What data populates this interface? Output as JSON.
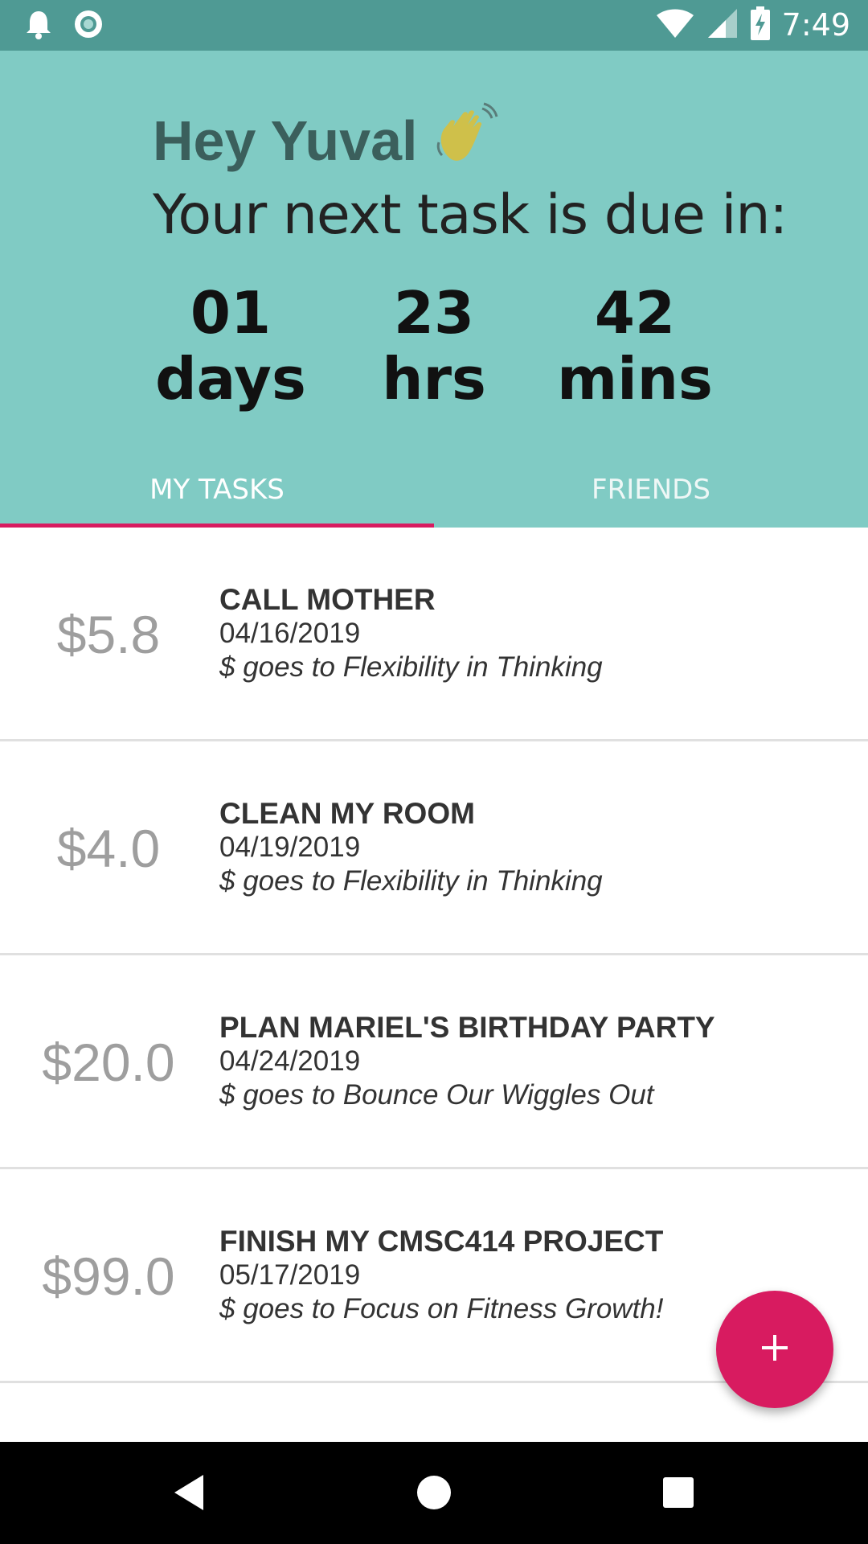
{
  "status_bar": {
    "time": "7:49",
    "icons": [
      "notification-bell-icon",
      "record-circle-icon",
      "wifi-icon",
      "cell-signal-icon",
      "battery-charging-icon"
    ]
  },
  "header": {
    "greeting": "Hey Yuval",
    "greeting_emoji_icon": "waving-hand-icon",
    "subtitle": "Your next task is due in:",
    "countdown": [
      {
        "value": "01",
        "unit": "days"
      },
      {
        "value": "23",
        "unit": "hrs"
      },
      {
        "value": "42",
        "unit": "mins"
      }
    ]
  },
  "tabs": [
    {
      "label": "MY TASKS",
      "selected": true
    },
    {
      "label": "FRIENDS",
      "selected": false
    }
  ],
  "tasks": [
    {
      "amount": "$5.8",
      "title": "CALL MOTHER",
      "date": "04/16/2019",
      "charity": "$ goes to Flexibility in Thinking"
    },
    {
      "amount": "$4.0",
      "title": "CLEAN MY ROOM",
      "date": "04/19/2019",
      "charity": "$ goes to Flexibility in Thinking"
    },
    {
      "amount": "$20.0",
      "title": "PLAN MARIEL'S BIRTHDAY PARTY",
      "date": "04/24/2019",
      "charity": "$ goes to Bounce Our Wiggles Out"
    },
    {
      "amount": "$99.0",
      "title": "FINISH MY CMSC414 PROJECT",
      "date": "05/17/2019",
      "charity": "$ goes to Focus on Fitness Growth!"
    }
  ],
  "fab": {
    "icon": "plus-icon"
  },
  "nav_bar": {
    "icons": [
      "back-triangle-icon",
      "home-circle-icon",
      "recents-square-icon"
    ]
  },
  "colors": {
    "status_bar": "#4f9a94",
    "header": "#80cbc4",
    "accent": "#d81b60",
    "amount_gray": "#9e9e9e"
  }
}
